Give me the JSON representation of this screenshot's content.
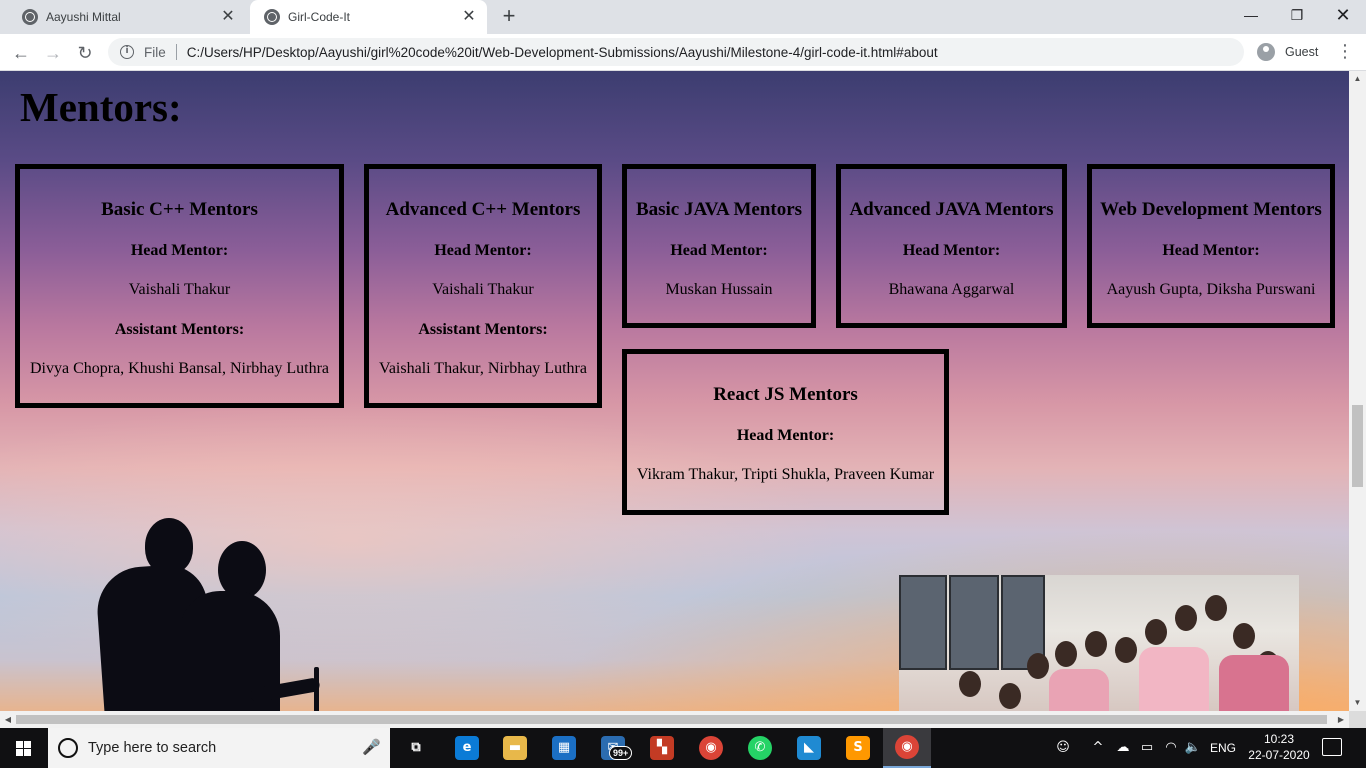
{
  "browser": {
    "tabs": [
      {
        "title": "Aayushi Mittal",
        "close": "✕"
      },
      {
        "title": "Girl-Code-It",
        "close": "✕"
      }
    ],
    "new_tab_glyph": "+",
    "window_controls": {
      "minimize": "—",
      "maximize": "❐",
      "close": "✕"
    },
    "nav": {
      "back": "←",
      "forward": "→",
      "reload": "↻"
    },
    "omnibox": {
      "info_glyph": "i",
      "scheme_label": "File",
      "url": "C:/Users/HP/Desktop/Aayushi/girl%20code%20it/Web-Development-Submissions/Aayushi/Milestone-4/girl-code-it.html#about"
    },
    "profile_label": "Guest",
    "menu_glyph": "⋮"
  },
  "page": {
    "heading": "Mentors:",
    "cards": [
      {
        "title": "Basic C++ Mentors",
        "head_label": "Head Mentor:",
        "head_names": "Vaishali Thakur",
        "assistant_label": "Assistant Mentors:",
        "assistant_names": "Divya Chopra, Khushi Bansal, Nirbhay Luthra"
      },
      {
        "title": "Advanced C++ Mentors",
        "head_label": "Head Mentor:",
        "head_names": "Vaishali Thakur",
        "assistant_label": "Assistant Mentors:",
        "assistant_names": "Vaishali Thakur, Nirbhay Luthra"
      },
      {
        "title": "Basic JAVA Mentors",
        "head_label": "Head Mentor:",
        "head_names": "Muskan Hussain"
      },
      {
        "title": "Advanced JAVA Mentors",
        "head_label": "Head Mentor:",
        "head_names": "Bhawana Aggarwal"
      },
      {
        "title": "Web Development Mentors",
        "head_label": "Head Mentor:",
        "head_names": "Aayush Gupta, Diksha Purswani"
      },
      {
        "title": "React JS Mentors",
        "head_label": "Head Mentor:",
        "head_names": "Vikram Thakur, Tripti Shukla, Praveen Kumar"
      }
    ],
    "text_color": "#000000"
  },
  "scrollbars": {
    "up": "▲",
    "down": "▼",
    "left": "◀",
    "right": "▶"
  },
  "taskbar": {
    "search_placeholder": "Type here to search",
    "mic_glyph": "🎤",
    "apps": [
      {
        "name": "task-view",
        "glyph": "⧉",
        "color": "#101012"
      },
      {
        "name": "edge",
        "glyph": "e",
        "color": "#0b7bd6"
      },
      {
        "name": "file-explorer",
        "glyph": "▬",
        "color": "#e8b84a"
      },
      {
        "name": "store",
        "glyph": "▦",
        "color": "#1b6fc4"
      },
      {
        "name": "mail",
        "glyph": "✉",
        "color": "#2b6cb0",
        "badge": "99+"
      },
      {
        "name": "office",
        "glyph": "▚",
        "color": "#c33b24"
      },
      {
        "name": "chrome",
        "glyph": "◉",
        "color": "#db4437"
      },
      {
        "name": "whatsapp",
        "glyph": "✆",
        "color": "#25d366"
      },
      {
        "name": "vscode",
        "glyph": "◣",
        "color": "#1f8ad2"
      },
      {
        "name": "sublime",
        "glyph": "S",
        "color": "#ff9800"
      },
      {
        "name": "chrome-active",
        "glyph": "◉",
        "color": "#db4437"
      }
    ],
    "tray": {
      "people_glyph": "☺",
      "chevron_glyph": "^",
      "cloud_glyph": "☁",
      "battery_glyph": "▭",
      "wifi_glyph": "◠",
      "volume_glyph": "🔈",
      "language": "ENG",
      "time": "10:23",
      "date": "22-07-2020"
    }
  }
}
